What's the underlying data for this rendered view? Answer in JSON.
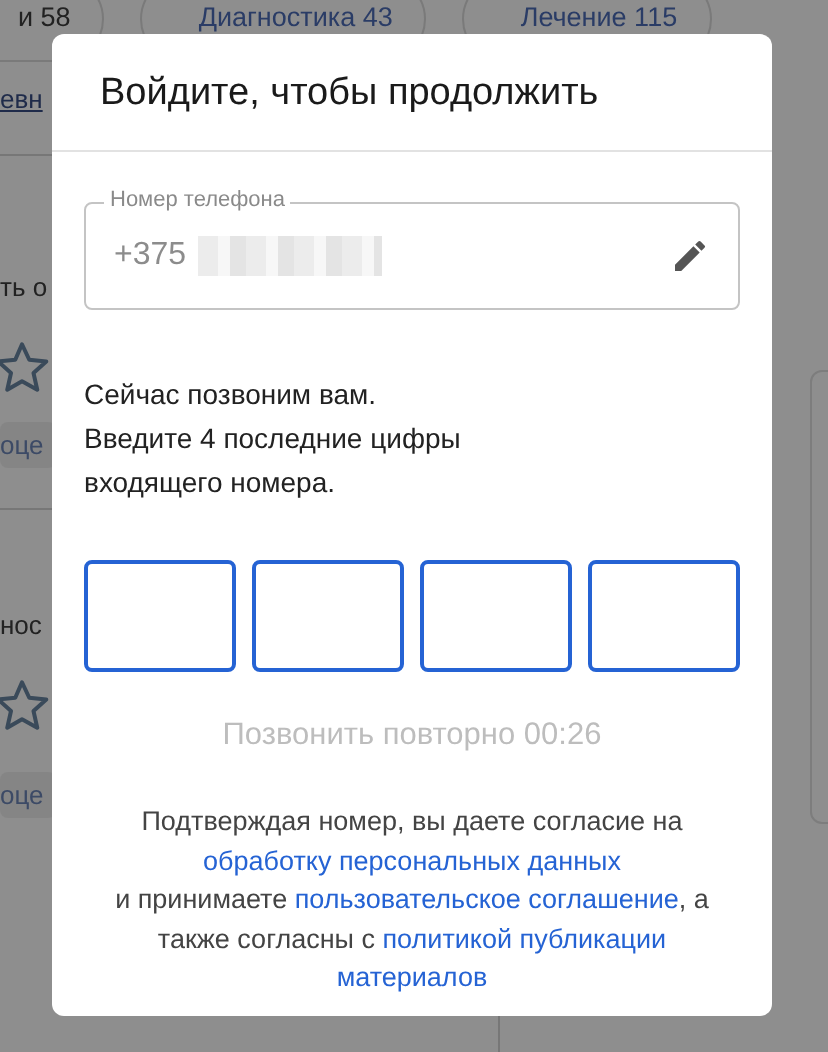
{
  "background": {
    "chips": [
      {
        "label": "и 58"
      },
      {
        "label": "Диагностика 43"
      },
      {
        "label": "Лечение 115"
      }
    ],
    "fragments": [
      {
        "kind": "link",
        "text": "евн"
      },
      {
        "kind": "text",
        "text": "ть о"
      },
      {
        "kind": "star"
      },
      {
        "kind": "tag",
        "text": "оце"
      },
      {
        "kind": "text",
        "text": "нос"
      },
      {
        "kind": "star"
      },
      {
        "kind": "tag",
        "text": "оце"
      }
    ]
  },
  "dialog": {
    "title": "Войдите, чтобы продолжить",
    "phone": {
      "label": "Номер телефона",
      "value": "+375"
    },
    "instructions": [
      "Сейчас позвоним вам.",
      "Введите 4 последние цифры",
      "входящего номера."
    ],
    "code_cells": [
      {
        "kind": "digit"
      },
      {
        "kind": "digit"
      },
      {
        "kind": "digit"
      },
      {
        "kind": "digit"
      }
    ],
    "retry": {
      "text": "Позвонить повторно 00:26",
      "disabled": true
    },
    "consent": [
      {
        "kind": "text",
        "text": "Подтверждая номер, вы даете согласие на "
      },
      {
        "kind": "link",
        "text": "обработку персональных данных"
      },
      {
        "kind": "break"
      },
      {
        "kind": "text",
        "text": "и принимаете "
      },
      {
        "kind": "link",
        "text": "пользовательское соглашение"
      },
      {
        "kind": "text",
        "text": ", а также согласны с "
      },
      {
        "kind": "link",
        "text": "политикой публикации"
      },
      {
        "kind": "break"
      },
      {
        "kind": "link",
        "text": "материалов"
      }
    ]
  }
}
